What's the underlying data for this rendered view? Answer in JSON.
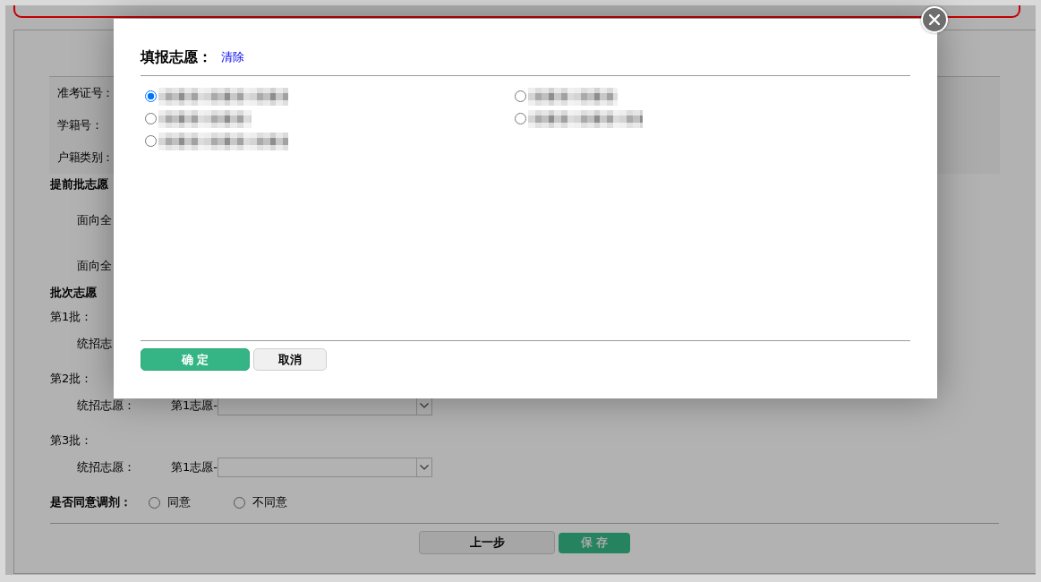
{
  "page": {
    "info_fields": [
      {
        "label": "准考证号："
      },
      {
        "label": "学籍号："
      },
      {
        "label": "户籍类别："
      }
    ],
    "early_batch": {
      "heading": "提前批志愿",
      "rows": [
        {
          "label": "面向全"
        },
        {
          "label": "面向全"
        }
      ]
    },
    "batch_choices": {
      "heading": "批次志愿",
      "batches": [
        {
          "label": "第1批：",
          "rows": [
            {
              "kind": "label",
              "label": "统招志"
            }
          ]
        },
        {
          "label": "第2批：",
          "rows": [
            {
              "kind": "select",
              "label": "统招志愿：",
              "choice_label": "第1志愿-"
            }
          ]
        },
        {
          "label": "第3批：",
          "rows": [
            {
              "kind": "select",
              "label": "统招志愿：",
              "choice_label": "第1志愿-"
            }
          ]
        }
      ]
    },
    "adjustment": {
      "label": "是否同意调剂：",
      "options": [
        {
          "label": "同意",
          "selected": false
        },
        {
          "label": "不同意",
          "selected": false
        }
      ]
    },
    "buttons": [
      {
        "label": "上一步",
        "kind": "secondary"
      },
      {
        "label": "保 存",
        "kind": "primary"
      }
    ]
  },
  "modal": {
    "title": "填报志愿：",
    "clear_link": "清除",
    "options": [
      {
        "selected": true
      },
      {
        "selected": false
      },
      {
        "selected": false
      },
      {
        "selected": false
      },
      {
        "selected": false
      }
    ],
    "buttons": [
      {
        "label": "确 定",
        "kind": "primary"
      },
      {
        "label": "取消",
        "kind": "secondary"
      }
    ]
  }
}
